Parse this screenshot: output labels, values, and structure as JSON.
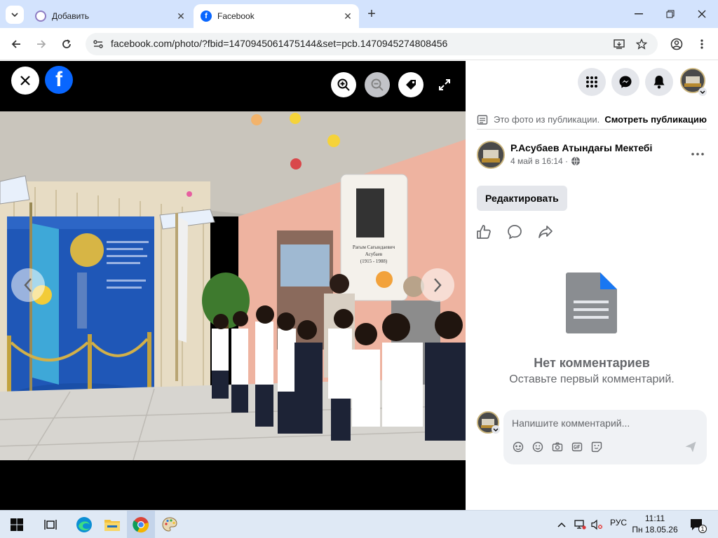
{
  "browser": {
    "tabs": [
      {
        "title": "Добавить",
        "active": false
      },
      {
        "title": "Facebook",
        "active": true
      }
    ],
    "url": "facebook.com/photo/?fbid=1470945061475144&set=pcb.1470945274808456"
  },
  "panel": {
    "publication_note": "Это фото из публикации.",
    "see_publication": "Смотреть публикацию",
    "author_name": "Р.Асубаев Атындағы Мектебі",
    "post_time": "4 май в 16:14 ·",
    "edit_label": "Редактировать",
    "no_comments_title": "Нет комментариев",
    "no_comments_sub": "Оставьте первый комментарий.",
    "comment_placeholder": "Напишите комментарий..."
  },
  "photo": {
    "portrait_caption_name": "Рағым Сағындаевич",
    "portrait_caption_surname": "Асубаев",
    "portrait_caption_years": "(1915 - 1988)"
  },
  "taskbar": {
    "language": "РУС",
    "time": "11:11",
    "date": "Пн 18.05.26",
    "notifications": "1"
  },
  "colors": {
    "tab_strip": "#d3e3fd",
    "facebook_blue": "#0866ff",
    "panel_button_bg": "#e4e6eb",
    "taskbar_bg": "#dfe9f5"
  }
}
